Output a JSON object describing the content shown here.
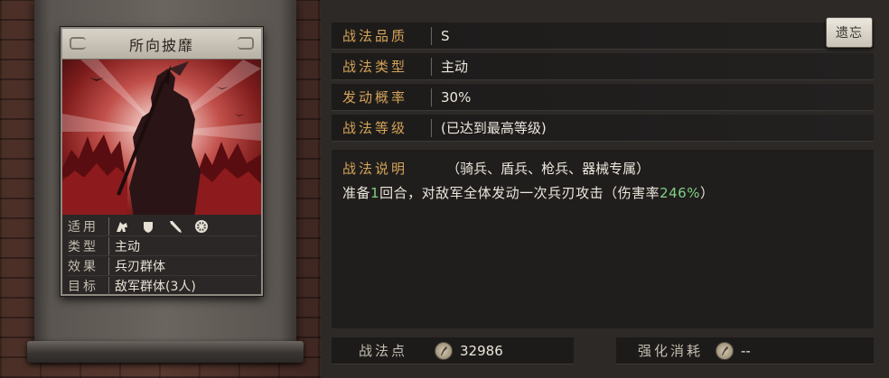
{
  "skill_card": {
    "name": "所向披靡",
    "info": [
      {
        "key": "适用",
        "value": ""
      },
      {
        "key": "类型",
        "value": "主动"
      },
      {
        "key": "效果",
        "value": "兵刃群体"
      },
      {
        "key": "目标",
        "value": "敌军群体(3人)"
      }
    ],
    "unit_icons": [
      "cavalry-icon",
      "shield-icon",
      "spear-icon",
      "siege-wheel-icon"
    ]
  },
  "attributes": [
    {
      "label": "战法品质",
      "value": "S"
    },
    {
      "label": "战法类型",
      "value": "主动"
    },
    {
      "label": "发动概率",
      "value": "30%"
    },
    {
      "label": "战法等级",
      "value": "(已达到最高等级)"
    }
  ],
  "forget_button": "遗忘",
  "description": {
    "label": "战法说明",
    "condition": "（骑兵、盾兵、枪兵、器械专属）",
    "text_before": "准备",
    "rounds": "1",
    "text_middle": "回合，对敌军全体发动一次兵刃攻击（伤害率",
    "rate": "246%",
    "text_after": "）"
  },
  "footer": {
    "points_label": "战法点",
    "points_value": "32986",
    "cost_label": "强化消耗",
    "cost_value": "--"
  },
  "colors": {
    "label_gold": "#d5a458",
    "highlight_green": "#7fd083"
  }
}
